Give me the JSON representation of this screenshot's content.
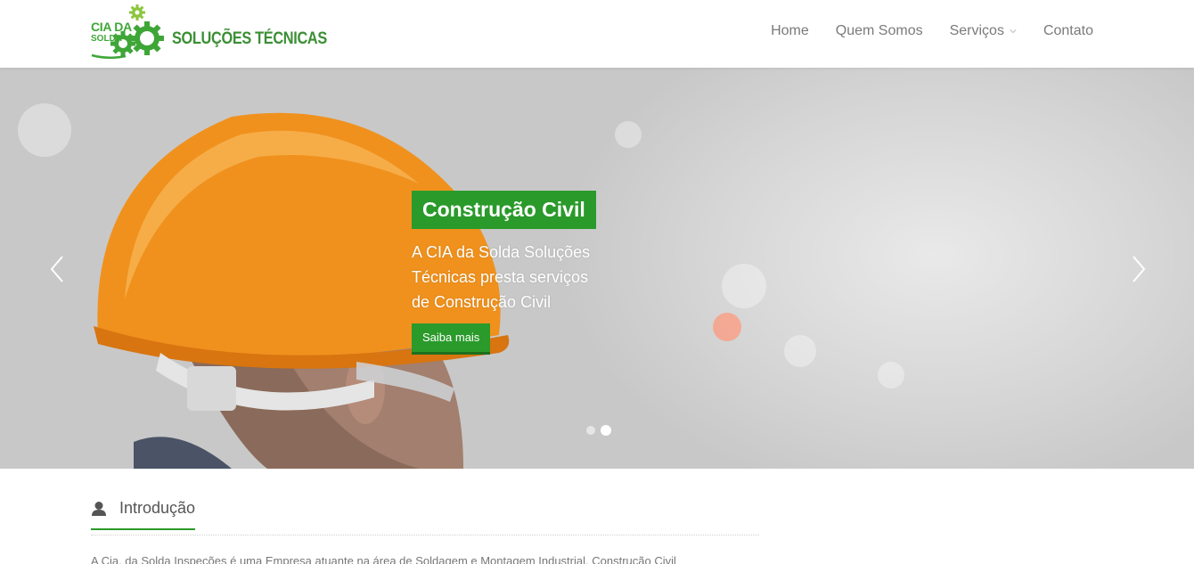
{
  "brand": {
    "logo_cia": "CIA DA",
    "logo_solda": "SOLDA",
    "logo_text": "SOLUÇÕES TÉCNICAS",
    "accent_color": "#2a9a2a"
  },
  "nav": {
    "items": [
      {
        "label": "Home"
      },
      {
        "label": "Quem Somos"
      },
      {
        "label": "Serviços",
        "icon": "chevron-down-icon"
      },
      {
        "label": "Contato"
      }
    ]
  },
  "slider": {
    "title": "Construção Civil",
    "description": "A CIA da Solda Soluções Técnicas presta serviços de Construção Civil",
    "button_label": "Saiba mais",
    "prev_icon": "chevron-left-icon",
    "next_icon": "chevron-right-icon",
    "slide_count": 2,
    "active_slide": 2
  },
  "intro": {
    "title": "Introdução",
    "icon": "user-icon",
    "text": "A Cia. da Solda Inspeções é uma Empresa atuante na área de Soldagem e Montagem Industrial, Construção Civil"
  }
}
